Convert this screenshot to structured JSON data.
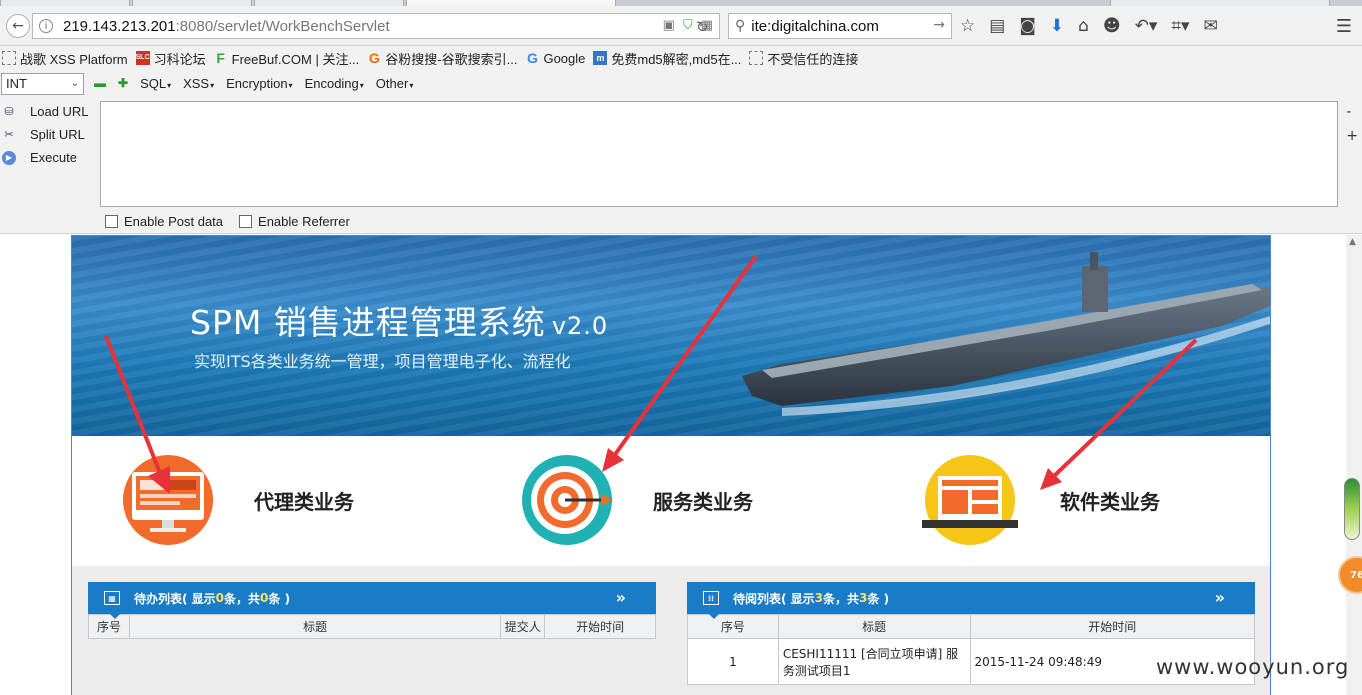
{
  "browser": {
    "url_host": "219.143.213.201",
    "url_rest": ":8080/servlet/WorkBenchServlet",
    "search_value": "ite:digitalchina.com"
  },
  "bookmarks": [
    {
      "label": "战歌 XSS Platform",
      "icon": "dashed-page-icon"
    },
    {
      "label": "习科论坛",
      "icon": "slc-icon"
    },
    {
      "label": "FreeBuf.COM | 关注...",
      "icon": "freebuf-icon"
    },
    {
      "label": "谷粉搜搜-谷歌搜索引...",
      "icon": "gufen-icon"
    },
    {
      "label": "Google",
      "icon": "google-icon"
    },
    {
      "label": "免费md5解密,md5在...",
      "icon": "md5-icon"
    },
    {
      "label": "不受信任的连接",
      "icon": "dashed-page-icon"
    }
  ],
  "hackbar": {
    "select_value": "INT",
    "menus": [
      "SQL",
      "XSS",
      "Encryption",
      "Encoding",
      "Other"
    ],
    "load_url": "Load URL",
    "split_url": "Split URL",
    "execute": "Execute",
    "enable_post": "Enable Post data",
    "enable_referrer": "Enable Referrer"
  },
  "page": {
    "title": "SPM 销售进程管理系统",
    "version": "v2.0",
    "subtitle": "实现ITS各类业务统一管理，项目管理电子化、流程化",
    "categories": [
      {
        "label": "代理类业务",
        "icon": "monitor-icon",
        "color": "#f26b2c"
      },
      {
        "label": "服务类业务",
        "icon": "target-icon",
        "color": "#1fb1b4"
      },
      {
        "label": "软件类业务",
        "icon": "laptop-icon",
        "color": "#f5c518"
      }
    ],
    "todo_panel": {
      "title_prefix": "待办列表( 显示 ",
      "count_shown": "0",
      "title_mid": " 条，共 ",
      "count_total": "0",
      "title_suffix": " 条 )",
      "columns": [
        "序号",
        "标题",
        "提交人",
        "开始时间"
      ]
    },
    "read_panel": {
      "title_prefix": "待阅列表( 显示 ",
      "count_shown": "3",
      "title_mid": " 条，共 ",
      "count_total": "3",
      "title_suffix": " 条 )",
      "columns": [
        "序号",
        "标题",
        "开始时间"
      ],
      "rows": [
        {
          "no": "1",
          "title": "CESHI11111 [合同立项申请] 服务测试项目1",
          "start": "2015-11-24 09:48:49"
        }
      ]
    }
  },
  "badge": "76",
  "watermark": "www.wooyun.org"
}
